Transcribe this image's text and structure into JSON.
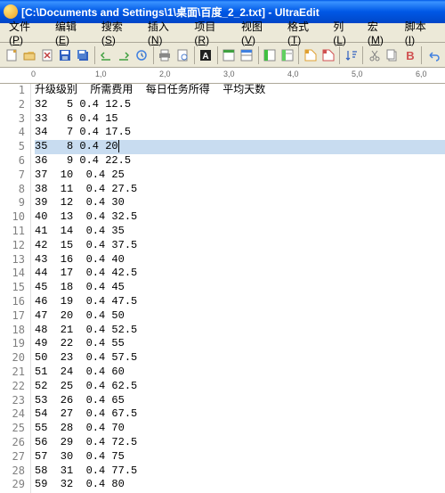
{
  "window": {
    "title": "[C:\\Documents and Settings\\1\\桌面\\百度_2_2.txt] - UltraEdit"
  },
  "menu": [
    {
      "label": "文件",
      "accel": "P"
    },
    {
      "label": "编辑",
      "accel": "E"
    },
    {
      "label": "搜索",
      "accel": "S"
    },
    {
      "label": "插入",
      "accel": "N"
    },
    {
      "label": "项目",
      "accel": "R"
    },
    {
      "label": "视图",
      "accel": "V"
    },
    {
      "label": "格式",
      "accel": "T"
    },
    {
      "label": "列",
      "accel": "L"
    },
    {
      "label": "宏",
      "accel": "M"
    },
    {
      "label": "脚本",
      "accel": "I"
    }
  ],
  "ruler_ticks": [
    {
      "pos": 0,
      "label": "0"
    },
    {
      "pos": 72,
      "label": "1,0"
    },
    {
      "pos": 144,
      "label": "2,0"
    },
    {
      "pos": 216,
      "label": "3,0"
    },
    {
      "pos": 288,
      "label": "4,0"
    },
    {
      "pos": 360,
      "label": "5,0"
    },
    {
      "pos": 432,
      "label": "6,0"
    }
  ],
  "header_line": "升级级别  所需费用  每日任务所得  平均天数",
  "selected_line": 5,
  "rows": [
    {
      "n": 2,
      "text": "32   5 0.4 12.5"
    },
    {
      "n": 3,
      "text": "33   6 0.4 15"
    },
    {
      "n": 4,
      "text": "34   7 0.4 17.5"
    },
    {
      "n": 5,
      "text": "35   8 0.4 20"
    },
    {
      "n": 6,
      "text": "36   9 0.4 22.5"
    },
    {
      "n": 7,
      "text": "37  10  0.4 25"
    },
    {
      "n": 8,
      "text": "38  11  0.4 27.5"
    },
    {
      "n": 9,
      "text": "39  12  0.4 30"
    },
    {
      "n": 10,
      "text": "40  13  0.4 32.5"
    },
    {
      "n": 11,
      "text": "41  14  0.4 35"
    },
    {
      "n": 12,
      "text": "42  15  0.4 37.5"
    },
    {
      "n": 13,
      "text": "43  16  0.4 40"
    },
    {
      "n": 14,
      "text": "44  17  0.4 42.5"
    },
    {
      "n": 15,
      "text": "45  18  0.4 45"
    },
    {
      "n": 16,
      "text": "46  19  0.4 47.5"
    },
    {
      "n": 17,
      "text": "47  20  0.4 50"
    },
    {
      "n": 18,
      "text": "48  21  0.4 52.5"
    },
    {
      "n": 19,
      "text": "49  22  0.4 55"
    },
    {
      "n": 20,
      "text": "50  23  0.4 57.5"
    },
    {
      "n": 21,
      "text": "51  24  0.4 60"
    },
    {
      "n": 22,
      "text": "52  25  0.4 62.5"
    },
    {
      "n": 23,
      "text": "53  26  0.4 65"
    },
    {
      "n": 24,
      "text": "54  27  0.4 67.5"
    },
    {
      "n": 25,
      "text": "55  28  0.4 70"
    },
    {
      "n": 26,
      "text": "56  29  0.4 72.5"
    },
    {
      "n": 27,
      "text": "57  30  0.4 75"
    },
    {
      "n": 28,
      "text": "58  31  0.4 77.5"
    },
    {
      "n": 29,
      "text": "59  32  0.4 80"
    }
  ],
  "icons": {
    "new": "#d4a040",
    "open": "#e8c060",
    "save": "#3060c0",
    "cut": "#808080",
    "copy": "#808080",
    "paste": "#c09040",
    "print": "#606060",
    "find": "#5080d0",
    "mark": "#202020",
    "box1": "#40a040",
    "box2": "#4080e0",
    "panel": "#40c040",
    "tag": "#e0a030",
    "sort": "#3060c0",
    "scissors": "#808080",
    "bold": "#d05050",
    "undo": "#4080e0"
  }
}
